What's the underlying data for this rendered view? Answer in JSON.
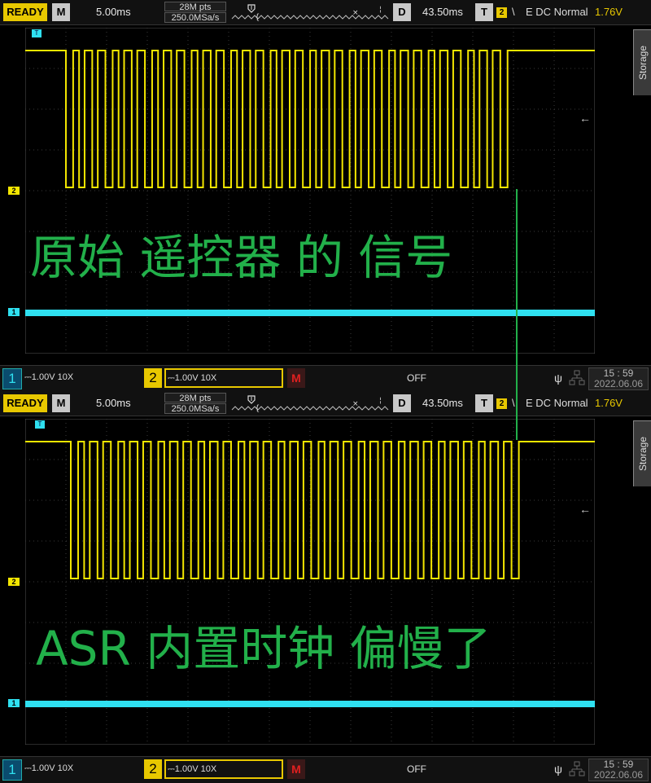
{
  "colors": {
    "ch1": "#2fe0f0",
    "ch2": "#f3e600",
    "overlay_text": "#22b04a",
    "ready": "#e8c800"
  },
  "top": {
    "status": "READY",
    "mode_button": "M",
    "timebase": "5.00ms",
    "memory_depth": "28M pts",
    "sample_rate": "250.0MSa/s",
    "delay_button": "D",
    "delay": "43.50ms",
    "trigger_button": "T",
    "trigger_channel": "2",
    "trigger_slope": "\\",
    "trigger_mode": "E DC Normal",
    "trigger_level": "1.76V",
    "storage_tab": "Storage",
    "overlay_text": "原始 遥控器 的 信号",
    "ch1_scale": "1.00V 10X",
    "ch2_scale": "1.00V 10X",
    "ch1_label": "1",
    "ch2_label": "2",
    "math_label": "M",
    "math_state": "OFF",
    "clock_time": "15 : 59",
    "clock_date": "2022.06.06",
    "waveform_bits": [
      0,
      1,
      0,
      1,
      0,
      1,
      0,
      1,
      0,
      1,
      0,
      1,
      0,
      1,
      0,
      1,
      0,
      1,
      0,
      1,
      0,
      1,
      0,
      1,
      0,
      1,
      0,
      1,
      0,
      1,
      0,
      1,
      0,
      1,
      0,
      1,
      0,
      1,
      0,
      1,
      0,
      1,
      0,
      1,
      0,
      1,
      0,
      1,
      0,
      1,
      0,
      1,
      0,
      1,
      0,
      1,
      0,
      1,
      0,
      1,
      0,
      1,
      0,
      1,
      0,
      1,
      0,
      1,
      0,
      1,
      0,
      1,
      0,
      1,
      0,
      1,
      0,
      1,
      0,
      1,
      0,
      1,
      0,
      1,
      0,
      1,
      0,
      1,
      0,
      1,
      0,
      1,
      0,
      1,
      0,
      1,
      0,
      1,
      0,
      1,
      0,
      1,
      0,
      1,
      0,
      1,
      0,
      1,
      0,
      1,
      0,
      1,
      0,
      1,
      0,
      1,
      0,
      1,
      0,
      1,
      0,
      1,
      0,
      1,
      0,
      1
    ]
  },
  "bottom": {
    "status": "READY",
    "mode_button": "M",
    "timebase": "5.00ms",
    "memory_depth": "28M pts",
    "sample_rate": "250.0MSa/s",
    "delay_button": "D",
    "delay": "43.50ms",
    "trigger_button": "T",
    "trigger_channel": "2",
    "trigger_slope": "\\",
    "trigger_mode": "E DC Normal",
    "trigger_level": "1.76V",
    "storage_tab": "Storage",
    "overlay_text": "ASR 内置时钟 偏慢了",
    "ch1_scale": "1.00V 10X",
    "ch2_scale": "1.00V 10X",
    "ch1_label": "1",
    "ch2_label": "2",
    "math_label": "M",
    "math_state": "OFF",
    "clock_time": "15 : 59",
    "clock_date": "2022.06.06"
  }
}
